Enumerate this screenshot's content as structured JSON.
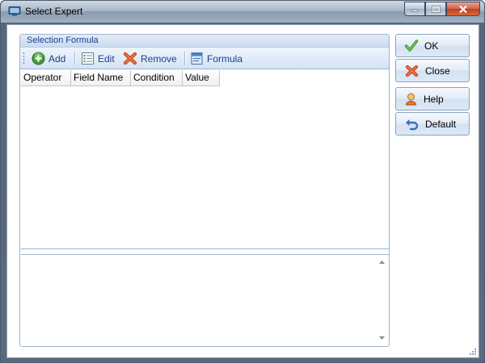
{
  "window": {
    "title": "Select Expert"
  },
  "panel": {
    "title": "Selection Formula",
    "toolbar": {
      "add": "Add",
      "edit": "Edit",
      "remove": "Remove",
      "formula": "Formula"
    },
    "columns": [
      "Operator",
      "Field Name",
      "Condition",
      "Value"
    ]
  },
  "buttons": {
    "ok": "OK",
    "close": "Close",
    "help": "Help",
    "default": "Default"
  },
  "icons": {
    "add": "add-icon",
    "edit": "edit-icon",
    "remove": "remove-icon",
    "formula": "formula-icon",
    "ok": "checkmark-icon",
    "close": "x-icon",
    "help": "help-icon",
    "default": "undo-icon"
  },
  "colors": {
    "toolbar_text": "#15428b",
    "title_bar": "#a9b8c8",
    "close_button": "#c03c22"
  }
}
